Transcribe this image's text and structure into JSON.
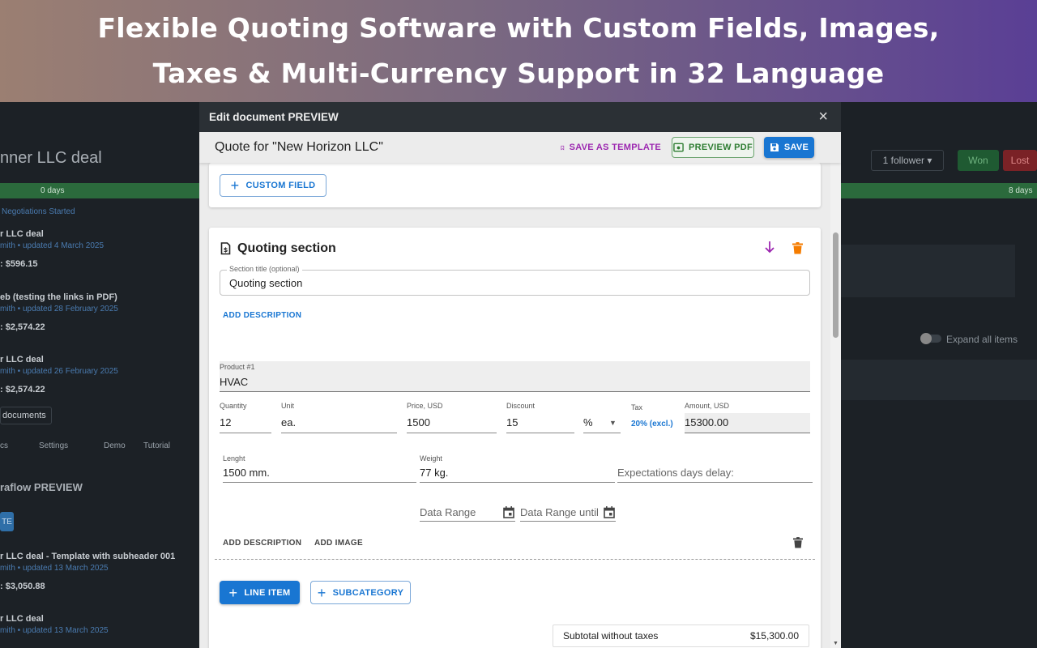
{
  "banner": {
    "line1": "Flexible Quoting Software with Custom Fields, Images,",
    "line2": "Taxes & Multi-Currency Support in 32 Language"
  },
  "background": {
    "deal_title": "nner LLC deal",
    "progress_left": "0 days",
    "progress_right": "8 days",
    "stage": "Negotiations Started",
    "follower": "1 follower",
    "won": "Won",
    "lost": "Lost",
    "expand_all": "Expand all items",
    "documents": [
      {
        "title": "r LLC deal",
        "meta": "mith • updated 4 March 2025",
        "total": ": $596.15"
      },
      {
        "title": "eb (testing the links in PDF)",
        "meta": "mith • updated 28 February 2025",
        "total": ": $2,574.22"
      },
      {
        "title": "r LLC deal",
        "meta": "mith • updated 26 February 2025",
        "total": ": $2,574.22"
      }
    ],
    "documents_tab": "documents",
    "tabs": [
      "cs",
      "Settings",
      "Demo",
      "Tutorial"
    ],
    "section2": "raflow PREVIEW",
    "btn_fragment": "TE",
    "documents2": [
      {
        "title": "r LLC deal - Template with subheader 001",
        "meta": "mith • updated 13 March 2025",
        "total": ": $3,050.88"
      },
      {
        "title": "r LLC deal",
        "meta": "mith • updated 13 March 2025"
      }
    ]
  },
  "modal": {
    "header": "Edit document PREVIEW",
    "close": "×",
    "doc_title": "Quote for \"New Horizon LLC\"",
    "save_as_template": "SAVE AS TEMPLATE",
    "preview_pdf": "PREVIEW PDF",
    "save": "SAVE",
    "custom_field_btn": "CUSTOM FIELD",
    "section": {
      "title": "Quoting section",
      "title_label": "Section title (optional)",
      "title_value": "Quoting section",
      "add_description": "ADD DESCRIPTION"
    },
    "product": {
      "label": "Product #1",
      "value": "HVAC",
      "quantity_label": "Quantity",
      "quantity": "12",
      "unit_label": "Unit",
      "unit": "ea.",
      "price_label": "Price, USD",
      "price": "1500",
      "discount_label": "Discount",
      "discount": "15",
      "discount_type": "%",
      "tax_label": "Tax",
      "tax": "20% (excl.)",
      "amount_label": "Amount, USD",
      "amount": "15300.00",
      "length_label": "Lenght",
      "length": "1500 mm.",
      "weight_label": "Weight",
      "weight": "77 kg.",
      "expectations_placeholder": "Expectations days delay:",
      "date_from_placeholder": "Data Range",
      "date_until_placeholder": "Data Range until",
      "add_description": "ADD DESCRIPTION",
      "add_image": "ADD IMAGE"
    },
    "line_item_btn": "LINE ITEM",
    "subcategory_btn": "SUBCATEGORY",
    "subtotal_label": "Subtotal without taxes",
    "subtotal_value": "$15,300.00"
  },
  "colors": {
    "primary": "#1976d2",
    "purple": "#9c27b0",
    "green": "#2e7d32",
    "orange": "#f57c00"
  }
}
